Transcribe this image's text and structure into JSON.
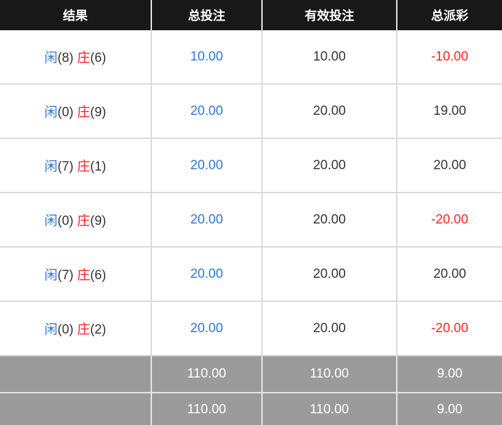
{
  "headers": {
    "result": "结果",
    "total_bet": "总投注",
    "valid_bet": "有效投注",
    "total_payout": "总派彩"
  },
  "rows": [
    {
      "player_label": "闲",
      "player_score": "(8)",
      "banker_label": "庄",
      "banker_score": "(6)",
      "total_bet": "10.00",
      "valid_bet": "10.00",
      "payout": "-10.00"
    },
    {
      "player_label": "闲",
      "player_score": "(0)",
      "banker_label": "庄",
      "banker_score": "(9)",
      "total_bet": "20.00",
      "valid_bet": "20.00",
      "payout": "19.00"
    },
    {
      "player_label": "闲",
      "player_score": "(7)",
      "banker_label": "庄",
      "banker_score": "(1)",
      "total_bet": "20.00",
      "valid_bet": "20.00",
      "payout": "20.00"
    },
    {
      "player_label": "闲",
      "player_score": "(0)",
      "banker_label": "庄",
      "banker_score": "(9)",
      "total_bet": "20.00",
      "valid_bet": "20.00",
      "payout": "-20.00"
    },
    {
      "player_label": "闲",
      "player_score": "(7)",
      "banker_label": "庄",
      "banker_score": "(6)",
      "total_bet": "20.00",
      "valid_bet": "20.00",
      "payout": "20.00"
    },
    {
      "player_label": "闲",
      "player_score": "(0)",
      "banker_label": "庄",
      "banker_score": "(2)",
      "total_bet": "20.00",
      "valid_bet": "20.00",
      "payout": "-20.00"
    }
  ],
  "subtotal": {
    "label": "",
    "total_bet": "110.00",
    "valid_bet": "110.00",
    "payout": "9.00"
  },
  "total": {
    "label": "",
    "total_bet": "110.00",
    "valid_bet": "110.00",
    "payout": "9.00"
  },
  "colors": {
    "header_bg": "#181818",
    "player": "#2f78d4",
    "banker": "#ff2222",
    "negative": "#ff2222",
    "positive": "#333333",
    "footer_bg": "#9b9b9b"
  }
}
